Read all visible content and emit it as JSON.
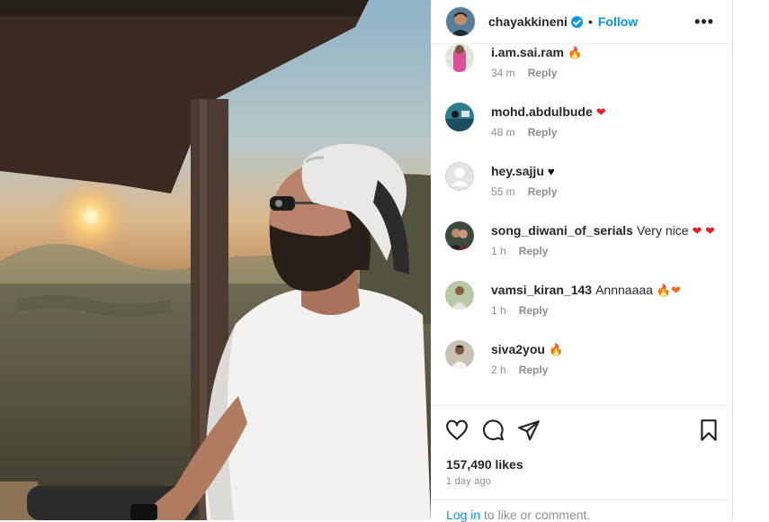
{
  "post": {
    "username": "chayakkineni",
    "dot": "•",
    "follow_label": "Follow",
    "more_label": "•••",
    "verified": true
  },
  "comments": [
    {
      "user": "i.am.sai.ram",
      "text": "",
      "emoji": "🔥",
      "emoji_class": "fire",
      "time": "34 m",
      "reply": "Reply",
      "avatar": "pink-figure"
    },
    {
      "user": "mohd.abdulbude",
      "text": "",
      "emoji": "❤",
      "emoji_class": "heart",
      "time": "48 m",
      "reply": "Reply",
      "avatar": "teal-scene"
    },
    {
      "user": "hey.sajju",
      "text": "",
      "emoji": "♥",
      "emoji_class": "blackheart",
      "time": "55 m",
      "reply": "Reply",
      "avatar": "default-gray"
    },
    {
      "user": "song_diwani_of_serials",
      "text": "Very nice",
      "emoji": "❤ ❤",
      "emoji_class": "heart",
      "time": "1 h",
      "reply": "Reply",
      "avatar": "couple"
    },
    {
      "user": "vamsi_kiran_143",
      "text": "Annnaaaa",
      "emoji": "🔥❤",
      "emoji_class": "fire",
      "time": "1 h",
      "reply": "Reply",
      "avatar": "person-outdoor"
    },
    {
      "user": "siva2you",
      "text": "",
      "emoji": "🔥",
      "emoji_class": "fire",
      "time": "2 h",
      "reply": "Reply",
      "avatar": "person-white"
    }
  ],
  "stats": {
    "likes": "157,490 likes",
    "posted": "1 day ago"
  },
  "login": {
    "link": "Log in",
    "rest": " to like or comment."
  },
  "colors": {
    "accent": "#0095f6",
    "heart": "#ed1c24",
    "muted": "#8e8e8e"
  }
}
